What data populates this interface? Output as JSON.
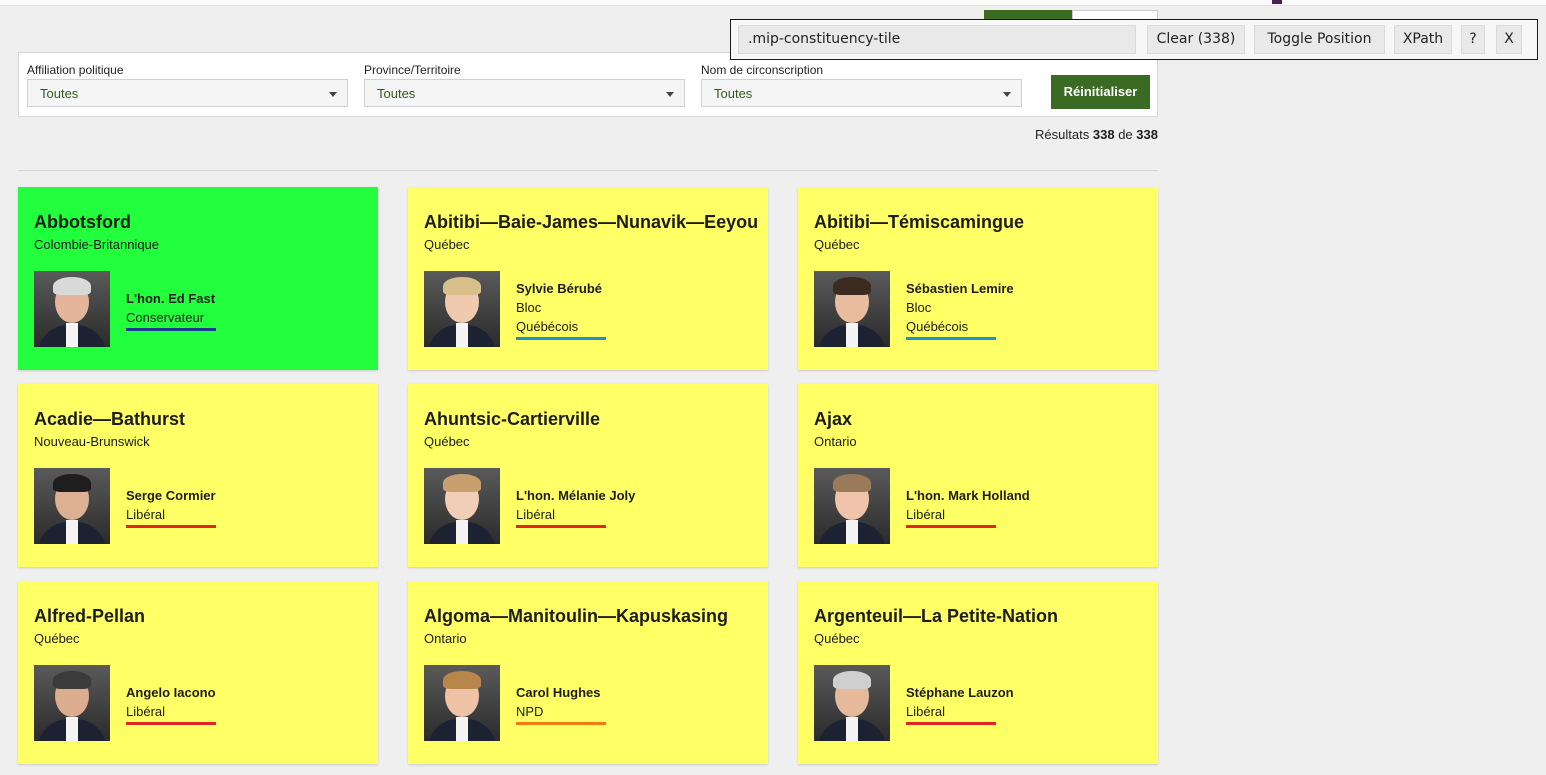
{
  "inspector": {
    "selector_value": ".mip-constituency-tile",
    "clear_label": "Clear (338)",
    "toggle_label": "Toggle Position",
    "xpath_label": "XPath",
    "help_label": "?",
    "close_label": "X"
  },
  "filters": {
    "affiliation": {
      "label": "Affiliation politique",
      "value": "Toutes"
    },
    "province": {
      "label": "Province/Territoire",
      "value": "Toutes"
    },
    "riding": {
      "label": "Nom de circonscription",
      "value": "Toutes"
    },
    "reset_label": "Réinitialiser"
  },
  "results": {
    "prefix": "Résultats",
    "count": "338",
    "of": "de",
    "total": "338"
  },
  "colors": {
    "accent_green": "#3b6a23",
    "tile_highlight": "#ffff66",
    "tile_active": "#22ff3c",
    "conservative": "#1b3a8f",
    "bloc": "#1f8fd6",
    "liberal": "#e0261f",
    "ndp": "#f07a10"
  },
  "tiles": [
    {
      "riding": "Abbotsford",
      "province": "Colombie-Britannique",
      "mp": "L'hon. Ed Fast",
      "party": "Conservateur",
      "party_color": "#1b3a8f",
      "active": true,
      "hair": "#d9d9d9",
      "skin": "#e4b59a"
    },
    {
      "riding": "Abitibi—Baie-James—Nunavik—Eeyou",
      "province": "Québec",
      "mp": "Sylvie Bérubé",
      "party": "Bloc\nQuébécois",
      "party_color": "#1f8fd6",
      "active": false,
      "hair": "#d8c08a",
      "skin": "#f0c9ae"
    },
    {
      "riding": "Abitibi—Témiscamingue",
      "province": "Québec",
      "mp": "Sébastien Lemire",
      "party": "Bloc\nQuébécois",
      "party_color": "#1f8fd6",
      "active": false,
      "hair": "#3a2a20",
      "skin": "#e8bc9f"
    },
    {
      "riding": "Acadie—Bathurst",
      "province": "Nouveau-Brunswick",
      "mp": "Serge Cormier",
      "party": "Libéral",
      "party_color": "#e0261f",
      "active": false,
      "hair": "#1e1e1e",
      "skin": "#ddb093"
    },
    {
      "riding": "Ahuntsic-Cartierville",
      "province": "Québec",
      "mp": "L'hon. Mélanie Joly",
      "party": "Libéral",
      "party_color": "#e0261f",
      "active": false,
      "hair": "#c8a070",
      "skin": "#f1cfb6"
    },
    {
      "riding": "Ajax",
      "province": "Ontario",
      "mp": "L'hon. Mark Holland",
      "party": "Libéral",
      "party_color": "#e0261f",
      "active": false,
      "hair": "#9a7a5a",
      "skin": "#f0c4aa"
    },
    {
      "riding": "Alfred-Pellan",
      "province": "Québec",
      "mp": "Angelo Iacono",
      "party": "Libéral",
      "party_color": "#e0261f",
      "active": false,
      "hair": "#3b3b3b",
      "skin": "#dcae8f"
    },
    {
      "riding": "Algoma—Manitoulin—Kapuskasing",
      "province": "Ontario",
      "mp": "Carol Hughes",
      "party": "NPD",
      "party_color": "#f07a10",
      "active": false,
      "hair": "#b8864a",
      "skin": "#efc3a5"
    },
    {
      "riding": "Argenteuil—La Petite-Nation",
      "province": "Québec",
      "mp": "Stéphane Lauzon",
      "party": "Libéral",
      "party_color": "#e0261f",
      "active": false,
      "hair": "#cfcfcf",
      "skin": "#e6b89c"
    }
  ]
}
